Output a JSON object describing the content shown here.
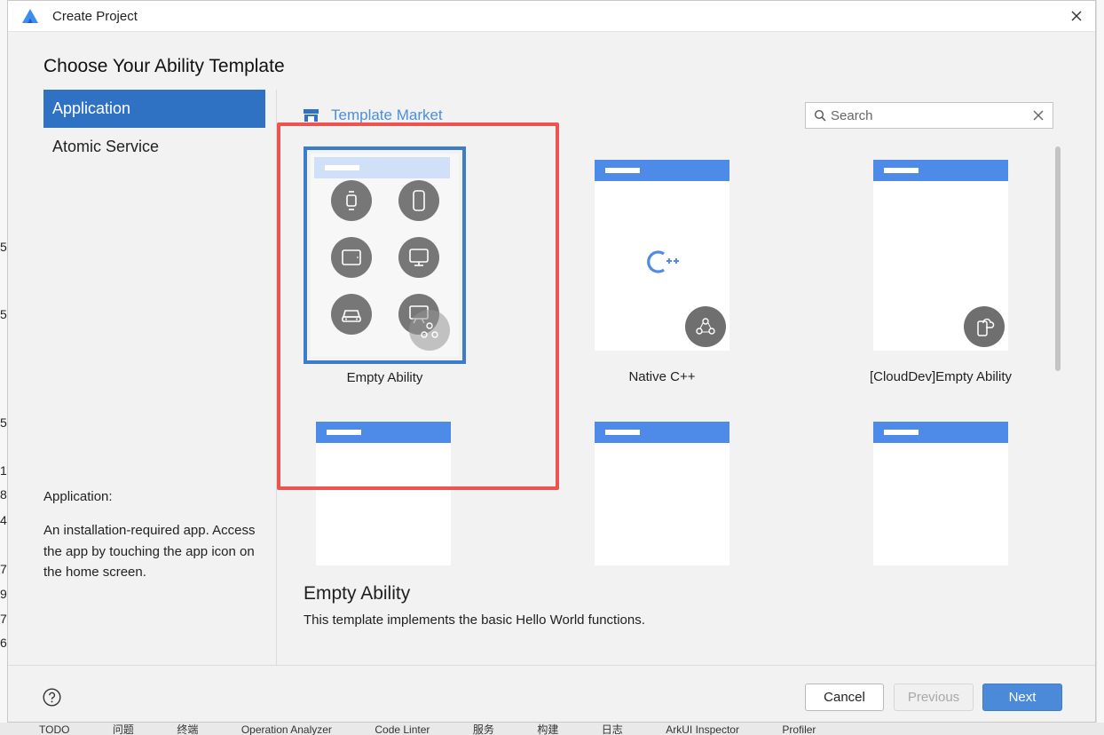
{
  "window": {
    "title": "Create Project",
    "logo_icon": "harmonyos-deveco-logo",
    "close_icon": "close-icon"
  },
  "heading": "Choose Your Ability Template",
  "nav": {
    "items": [
      {
        "label": "Application",
        "selected": true
      },
      {
        "label": "Atomic Service",
        "selected": false
      }
    ]
  },
  "description": {
    "title": "Application:",
    "text": "An installation-required app. Access the app by touching the app icon on the home screen."
  },
  "market": {
    "label": "Template Market",
    "icon": "store-icon"
  },
  "search": {
    "placeholder": "Search",
    "value": ""
  },
  "templates": [
    {
      "label": "Empty Ability",
      "selected": true
    },
    {
      "label": "Native C++",
      "selected": false
    },
    {
      "label": "[CloudDev]Empty Ability",
      "selected": false
    },
    {
      "label": "",
      "selected": false
    },
    {
      "label": "",
      "selected": false
    },
    {
      "label": "",
      "selected": false
    }
  ],
  "native_cpp_glyph": "C++",
  "detail": {
    "title": "Empty Ability",
    "text": "This template implements the basic Hello World functions."
  },
  "footer": {
    "help_icon": "help-icon",
    "cancel": "Cancel",
    "previous": "Previous",
    "next": "Next"
  },
  "colors": {
    "accent": "#2f72c4",
    "card_bar": "#4e8ae8",
    "annotation": "#ef5350",
    "next_button": "#4b8ad8"
  },
  "background": {
    "left_digits": [
      "5",
      "5",
      "5",
      "1",
      "8",
      "4",
      "7",
      "9",
      "7",
      "6"
    ],
    "bottom_tabs": [
      "TODO",
      "问题",
      "终端",
      "Operation Analyzer",
      "Code Linter",
      "服务",
      "构建",
      "日志",
      "ArkUI Inspector",
      "Profiler"
    ]
  }
}
